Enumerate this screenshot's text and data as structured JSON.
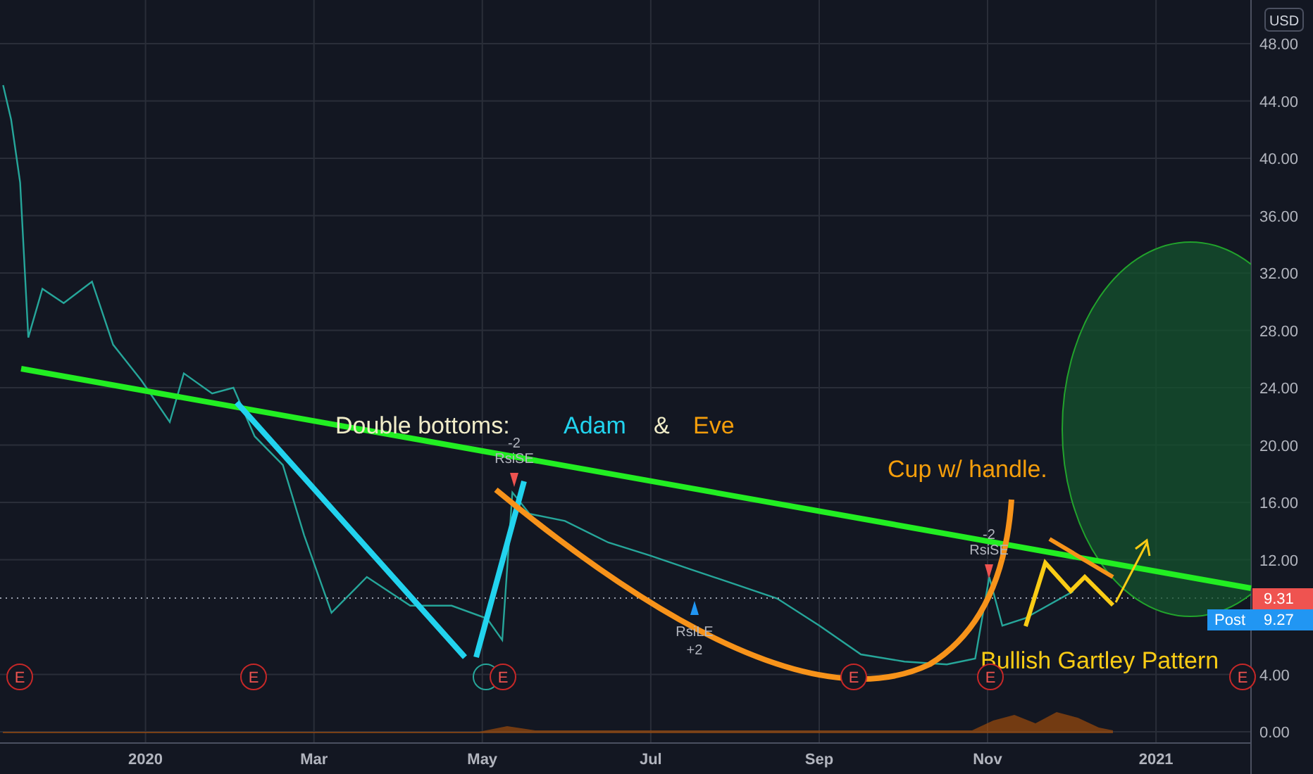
{
  "price_scale": {
    "currency": "USD",
    "last_price": "9.31",
    "post_label": "Post",
    "post_price": "9.27"
  },
  "chart_data": {
    "type": "line",
    "grid": true,
    "xlim": [
      2019.856,
      2021.094
    ],
    "ylim": [
      0,
      48
    ],
    "x": [
      2019.859,
      2019.867,
      2019.876,
      2019.884,
      2019.898,
      2019.919,
      2019.947,
      2019.968,
      2019.996,
      2020.024,
      2020.038,
      2020.066,
      2020.087,
      2020.108,
      2020.136,
      2020.157,
      2020.184,
      2020.219,
      2020.262,
      2020.303,
      2020.338,
      2020.353,
      2020.363,
      2020.38,
      2020.415,
      2020.458,
      2020.499,
      2020.541,
      2020.583,
      2020.625,
      2020.667,
      2020.708,
      2020.751,
      2020.793,
      2020.821,
      2020.835,
      2020.848,
      2020.87,
      2020.918
    ],
    "series": [
      {
        "color": "#26a69a",
        "values": [
          45.1,
          42.7,
          38.3,
          27.5,
          30.9,
          29.9,
          31.4,
          27,
          24.5,
          21.6,
          25,
          23.6,
          24,
          20.6,
          18.6,
          13.7,
          8.3,
          10.8,
          8.8,
          8.8,
          7.9,
          6.4,
          16.7,
          15.2,
          14.7,
          13.2,
          12.3,
          11.3,
          10.3,
          9.3,
          7.4,
          5.4,
          4.9,
          4.7,
          5.1,
          10.8,
          7.4,
          7.9,
          9.8
        ]
      }
    ],
    "xticks": [
      {
        "value": 2020,
        "label": "2020"
      },
      {
        "value": 2020.1667,
        "label": "Mar"
      },
      {
        "value": 2020.3333,
        "label": "May"
      },
      {
        "value": 2020.5,
        "label": "Jul"
      },
      {
        "value": 2020.6667,
        "label": "Sep"
      },
      {
        "value": 2020.8333,
        "label": "Nov"
      },
      {
        "value": 2021,
        "label": "2021"
      }
    ],
    "yticks": [
      {
        "value": 0,
        "label": "0.00"
      },
      {
        "value": 4,
        "label": "4.00"
      },
      {
        "value": 12,
        "label": "12.00"
      },
      {
        "value": 16,
        "label": "16.00"
      },
      {
        "value": 20,
        "label": "20.00"
      },
      {
        "value": 24,
        "label": "24.00"
      },
      {
        "value": 28,
        "label": "28.00"
      },
      {
        "value": 32,
        "label": "32.00"
      },
      {
        "value": 36,
        "label": "36.00"
      },
      {
        "value": 40,
        "label": "40.00"
      },
      {
        "value": 44,
        "label": "44.00"
      },
      {
        "value": 48,
        "label": "48.00"
      }
    ]
  },
  "drawing_labels": [
    {
      "text": "Double bottoms:",
      "color": "#f0ecc8"
    },
    {
      "text": "Adam",
      "color": "#22d3ee"
    },
    {
      "text": "&",
      "color": "#f0ecc8"
    },
    {
      "text": "Eve",
      "color": "#f59e0b"
    },
    {
      "text": "Cup w/ handle.",
      "color": "#f59e0b"
    },
    {
      "text": "Bullish Gartley Pattern",
      "color": "#facc15"
    }
  ],
  "signals": [
    {
      "kind": "short",
      "count": "-2",
      "label": "RsiSE"
    },
    {
      "kind": "long",
      "count": "+2",
      "label": "RsiLE"
    },
    {
      "kind": "short",
      "count": "-2",
      "label": "RsiSE"
    }
  ],
  "earnings_markers": [
    "E",
    "E",
    "E",
    "E",
    "E",
    "E"
  ]
}
